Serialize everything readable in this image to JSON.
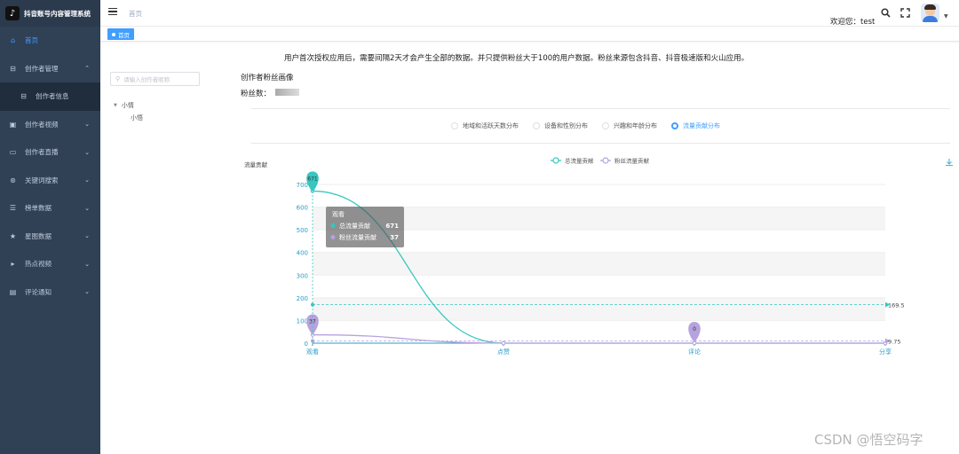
{
  "app": {
    "title": "抖音账号内容管理系统",
    "logo_icon": "tiktok-logo"
  },
  "sidebar": {
    "items": [
      {
        "label": "首页",
        "icon": "home-icon",
        "active": true
      },
      {
        "label": "创作者管理",
        "icon": "creator-icon",
        "expanded": true
      },
      {
        "label": "创作者信息",
        "icon": "person-icon",
        "sub": true
      },
      {
        "label": "创作者视频",
        "icon": "video-icon"
      },
      {
        "label": "创作者直播",
        "icon": "monitor-icon"
      },
      {
        "label": "关键词搜索",
        "icon": "search-icon"
      },
      {
        "label": "榜单数据",
        "icon": "list-icon"
      },
      {
        "label": "星图数据",
        "icon": "star-icon"
      },
      {
        "label": "热点视频",
        "icon": "play-icon"
      },
      {
        "label": "评论通知",
        "icon": "comment-icon"
      }
    ]
  },
  "header": {
    "breadcrumb": "首页",
    "welcome": "欢迎您：test"
  },
  "tags": {
    "home": "首页"
  },
  "main": {
    "notice": "用户首次授权应用后，需要间隔2天才会产生全部的数据。并只提供粉丝大于100的用户数据。粉丝来源包含抖音、抖音极速版和火山应用。",
    "search_placeholder": "请输入创作者昵称",
    "tree": {
      "parent": "小情",
      "child": "小悟"
    },
    "section_title": "创作者粉丝画像",
    "fans_label": "粉丝数：",
    "radios": [
      {
        "label": "地域和活跃天数分布",
        "checked": false
      },
      {
        "label": "设备和性别分布",
        "checked": false
      },
      {
        "label": "兴趣和年龄分布",
        "checked": false
      },
      {
        "label": "流量贡献分布",
        "checked": true
      }
    ]
  },
  "chart_data": {
    "type": "line",
    "ylabel": "流量贡献",
    "categories": [
      "观看",
      "点赞",
      "评论",
      "分享"
    ],
    "ylim": [
      0,
      700
    ],
    "yticks": [
      0,
      100,
      200,
      300,
      400,
      500,
      600,
      700
    ],
    "series": [
      {
        "name": "总流量贡献",
        "color": "#37c6c0",
        "values": [
          671,
          0,
          0,
          0
        ],
        "max_label": "671",
        "avg": 169.5,
        "avg_label": "169.5"
      },
      {
        "name": "粉丝流量贡献",
        "color": "#b6a2de",
        "values": [
          37,
          0,
          0,
          0
        ],
        "max_label": "37",
        "min_label": "0",
        "avg": 9.75,
        "avg_label": "9.75"
      }
    ],
    "tooltip": {
      "title": "观看",
      "rows": [
        {
          "name": "总流量贡献",
          "value": "671"
        },
        {
          "name": "粉丝流量贡献",
          "value": "37"
        }
      ]
    }
  },
  "watermark": "CSDN @悟空码字",
  "colors": {
    "sidebar": "#304156",
    "accent": "#409eff",
    "teal": "#37c6c0",
    "purple": "#b6a2de"
  }
}
